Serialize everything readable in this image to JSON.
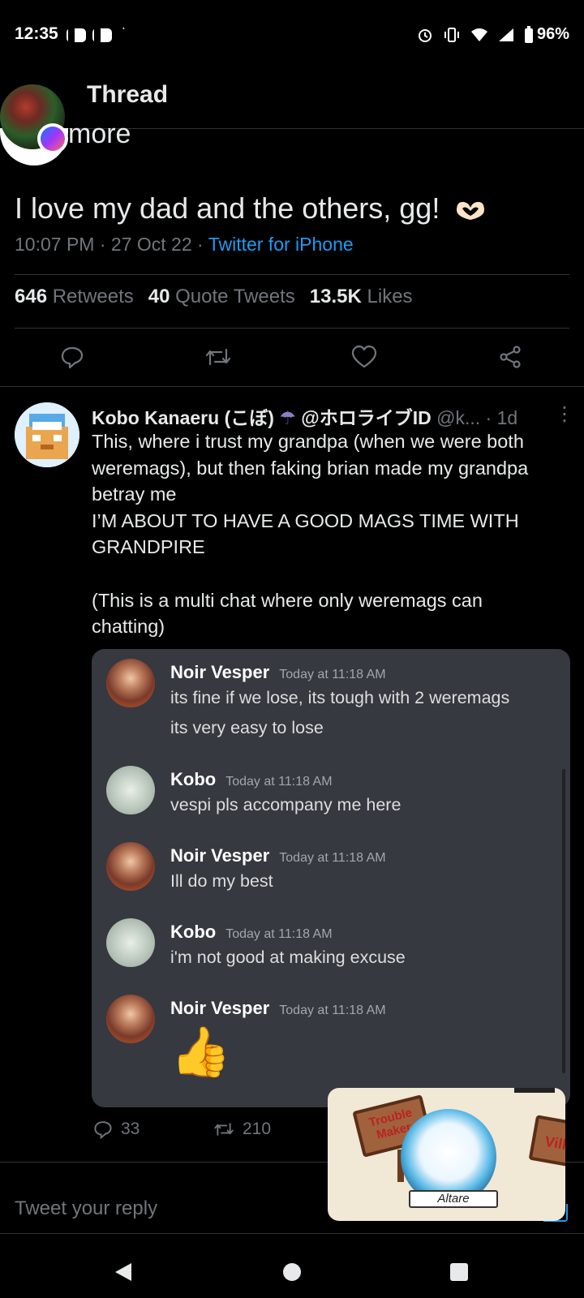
{
  "status_bar": {
    "time": "12:35",
    "battery": "96%"
  },
  "header": {
    "title": "Thread",
    "more_label": "more"
  },
  "tweet": {
    "text": "I love my dad and the others, gg!",
    "time": "10:07 PM",
    "date": "27 Oct 22",
    "source": "Twitter for iPhone",
    "sep": "·",
    "retweets_count": "646",
    "retweets_label": "Retweets",
    "quotes_count": "40",
    "quotes_label": "Quote Tweets",
    "likes_count": "13.5K",
    "likes_label": "Likes"
  },
  "reply": {
    "name": "Kobo Kanaeru (こぼ)",
    "handle_id": "@ホロライブID",
    "handle_tail": "@k...",
    "age": "· 1d",
    "lines": [
      "This, where i trust my grandpa (when we were both",
      "weremags), but then faking brian made my grandpa",
      "betray me",
      "I’M ABOUT TO HAVE A GOOD MAGS TIME WITH",
      "GRANDPIRE",
      "",
      "(This is a multi chat where only weremags can",
      "chatting)"
    ],
    "reply_count": "33",
    "retweet_count": "210"
  },
  "discord": {
    "messages": [
      {
        "author": "Noir Vesper",
        "time": "Today at 11:18 AM",
        "lines": [
          "its fine if we lose, its tough with 2 weremags",
          "its very easy to lose"
        ]
      },
      {
        "author": "Kobo",
        "time": "Today at 11:18 AM",
        "lines": [
          "vespi pls accompany me here"
        ]
      },
      {
        "author": "Noir Vesper",
        "time": "Today at 11:18 AM",
        "lines": [
          "Ill do my best"
        ]
      },
      {
        "author": "Kobo",
        "time": "Today at 11:18 AM",
        "lines": [
          "i'm not good at making excuse"
        ]
      },
      {
        "author": "Noir Vesper",
        "time": "Today at 11:18 AM",
        "lines": [
          "👍"
        ]
      }
    ]
  },
  "video_overlay": {
    "sign_left": "Trouble Maker",
    "sign_right": "Vill",
    "banner": "Altare"
  },
  "compose": {
    "placeholder": "Tweet your reply"
  },
  "colors": {
    "accent": "#1d9bf0",
    "muted": "#71767b",
    "discord_bg": "#36393f"
  }
}
